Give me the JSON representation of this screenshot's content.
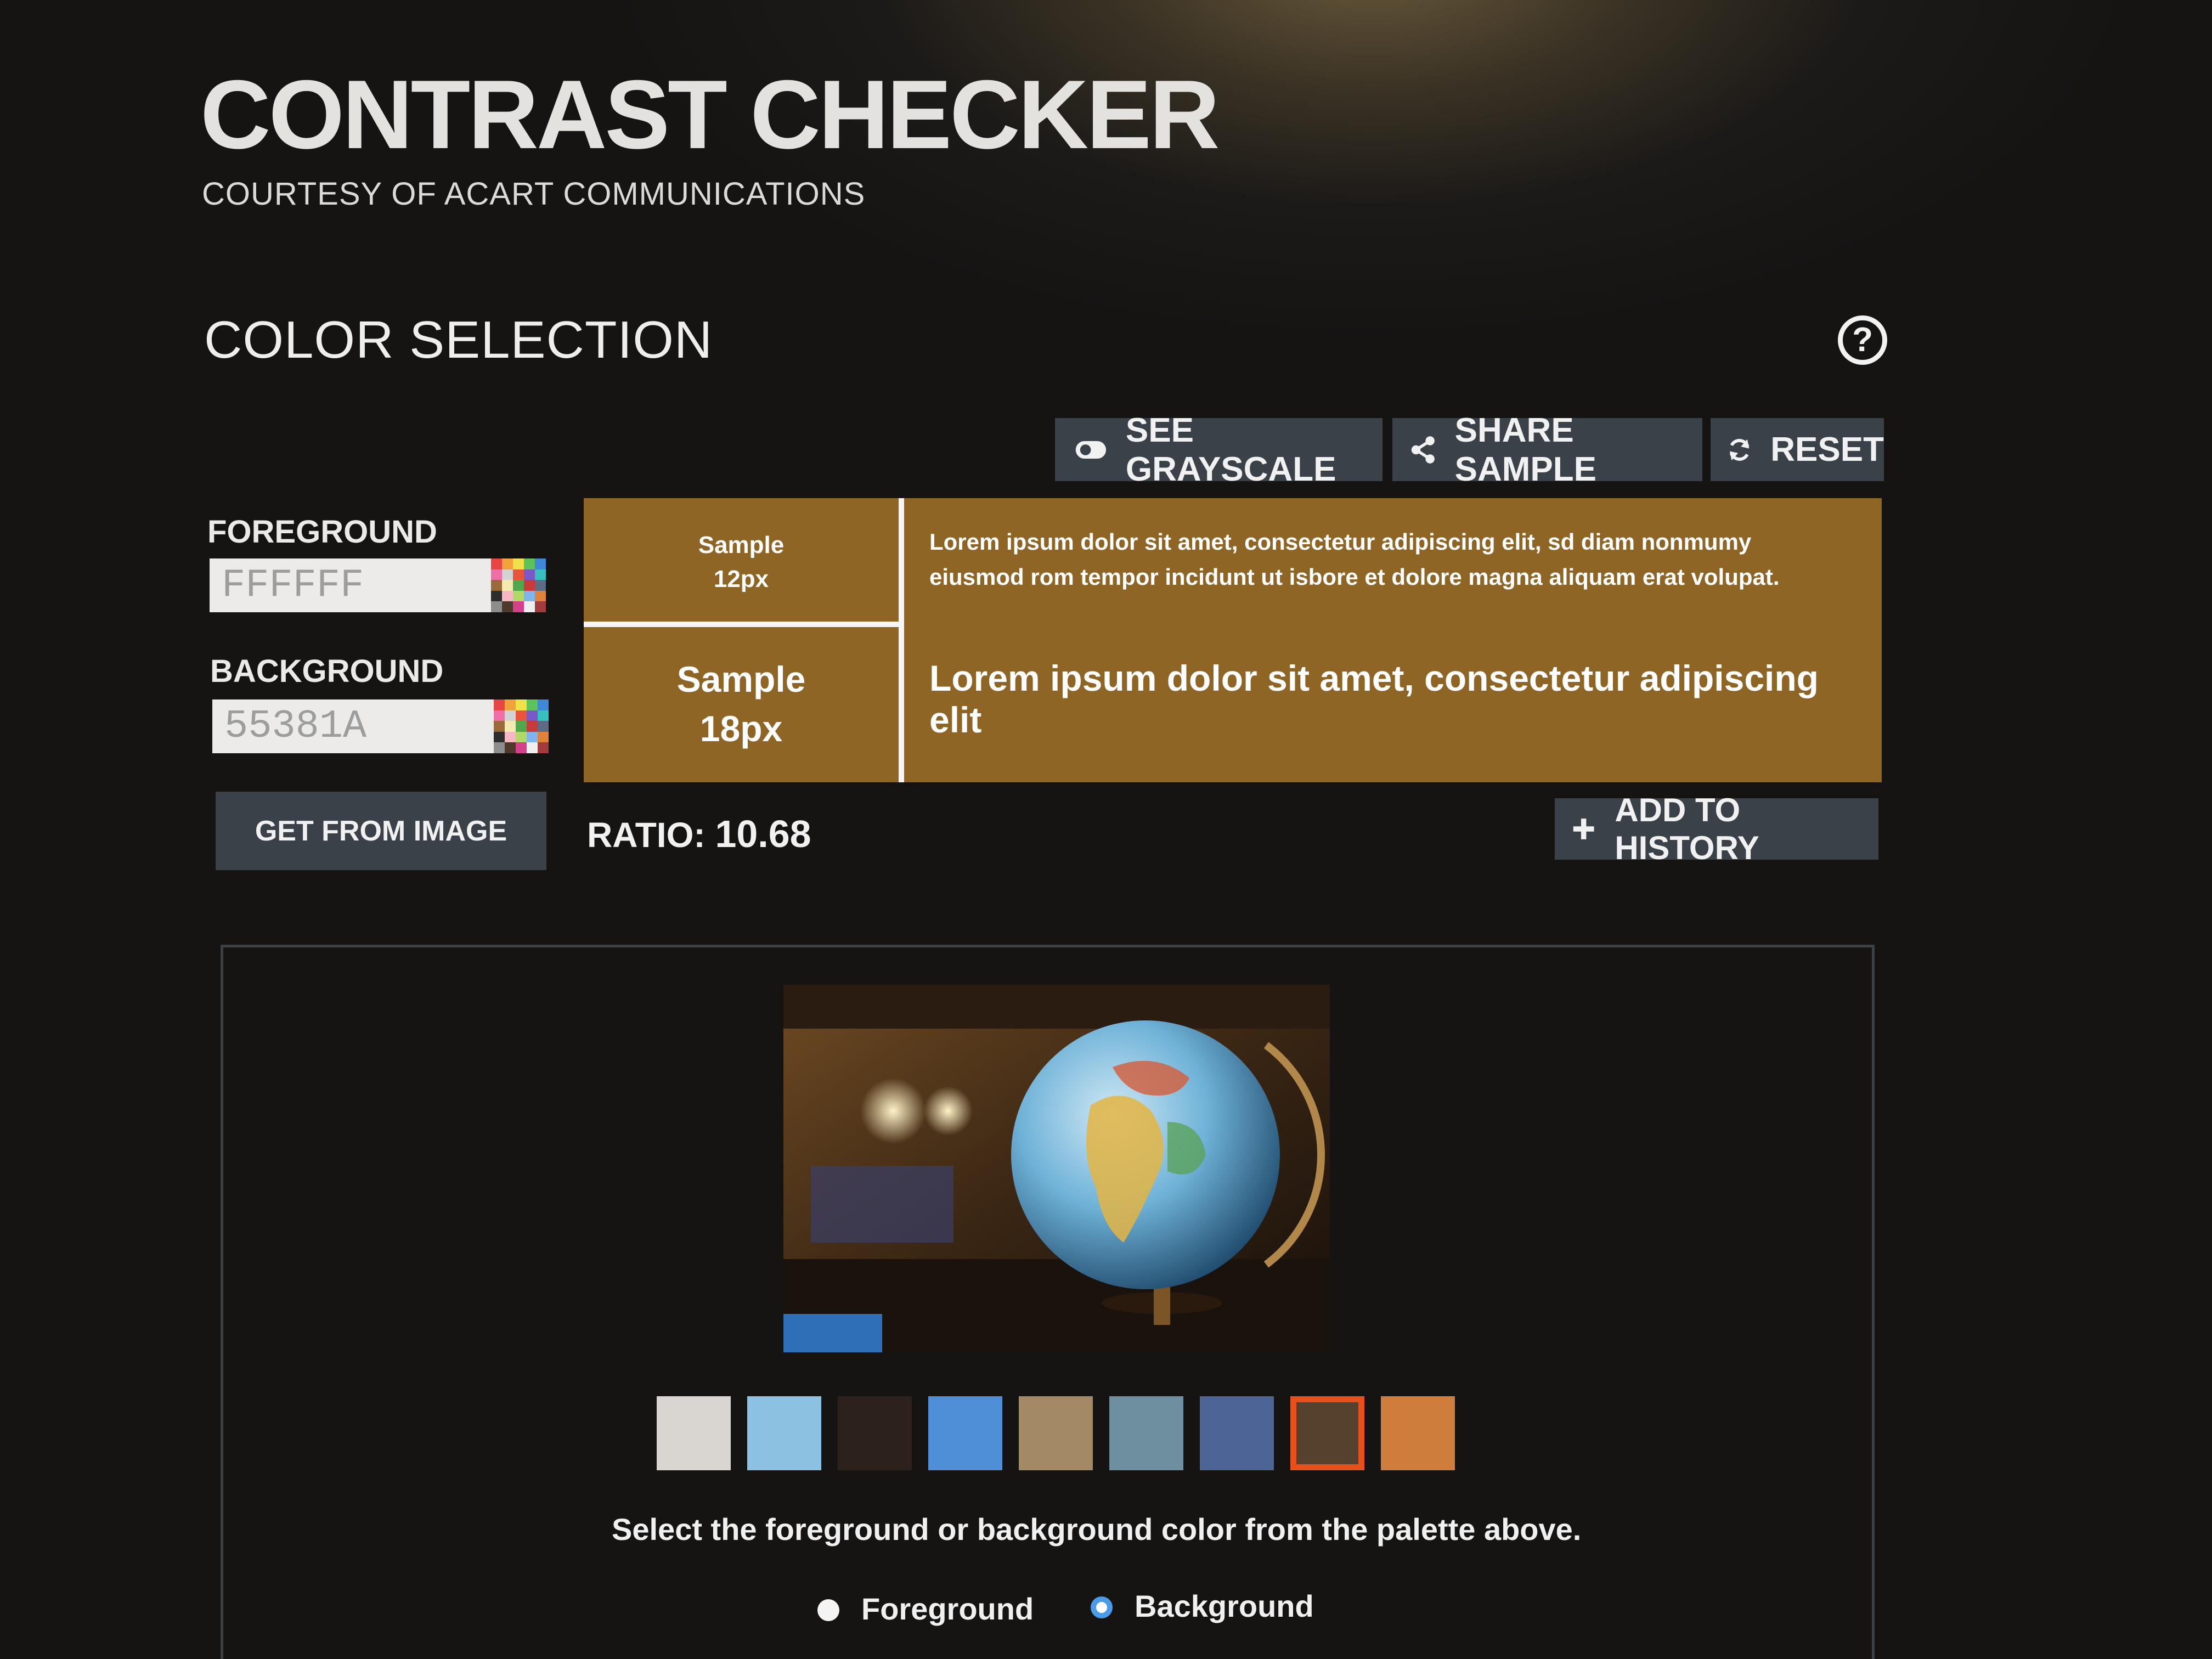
{
  "header": {
    "title": "CONTRAST CHECKER",
    "subtitle": "COURTESY OF ACART COMMUNICATIONS"
  },
  "section": {
    "title": "COLOR SELECTION",
    "help_icon": "question-circle-icon"
  },
  "toolbar": {
    "grayscale_label": "SEE GRAYSCALE",
    "share_label": "SHARE SAMPLE",
    "reset_label": "RESET"
  },
  "colors": {
    "foreground_label": "FOREGROUND",
    "foreground_value": "FFFFFF",
    "background_label": "BACKGROUND",
    "background_value": "55381A",
    "get_from_image_label": "GET FROM IMAGE"
  },
  "sample": {
    "small_label_line1": "Sample",
    "small_label_line2": "12px",
    "large_label_line1": "Sample",
    "large_label_line2": "18px",
    "small_text": "Lorem ipsum dolor sit amet, consectetur adipiscing elit, sd diam nonmumy eiusmod rom tempor incidunt ut isbore et dolore magna aliquam erat volupat.",
    "large_text": "Lorem ipsum dolor sit amet, consectetur adipiscing elit",
    "bg_color": "#8e6525"
  },
  "result": {
    "ratio_label": "RATIO:",
    "ratio_value": "10.68",
    "add_history_label": "ADD TO HISTORY"
  },
  "image_picker": {
    "palette": [
      "#d9d6d1",
      "#8cc1e1",
      "#2d221b",
      "#4f8fd8",
      "#a48965",
      "#6e8f9f",
      "#4c6596",
      "#55412e",
      "#cf7d3d"
    ],
    "selected_index": 7,
    "hint": "Select the foreground or background color from the palette above.",
    "foreground_option": "Foreground",
    "background_option": "Background",
    "selected_option": "Background"
  }
}
